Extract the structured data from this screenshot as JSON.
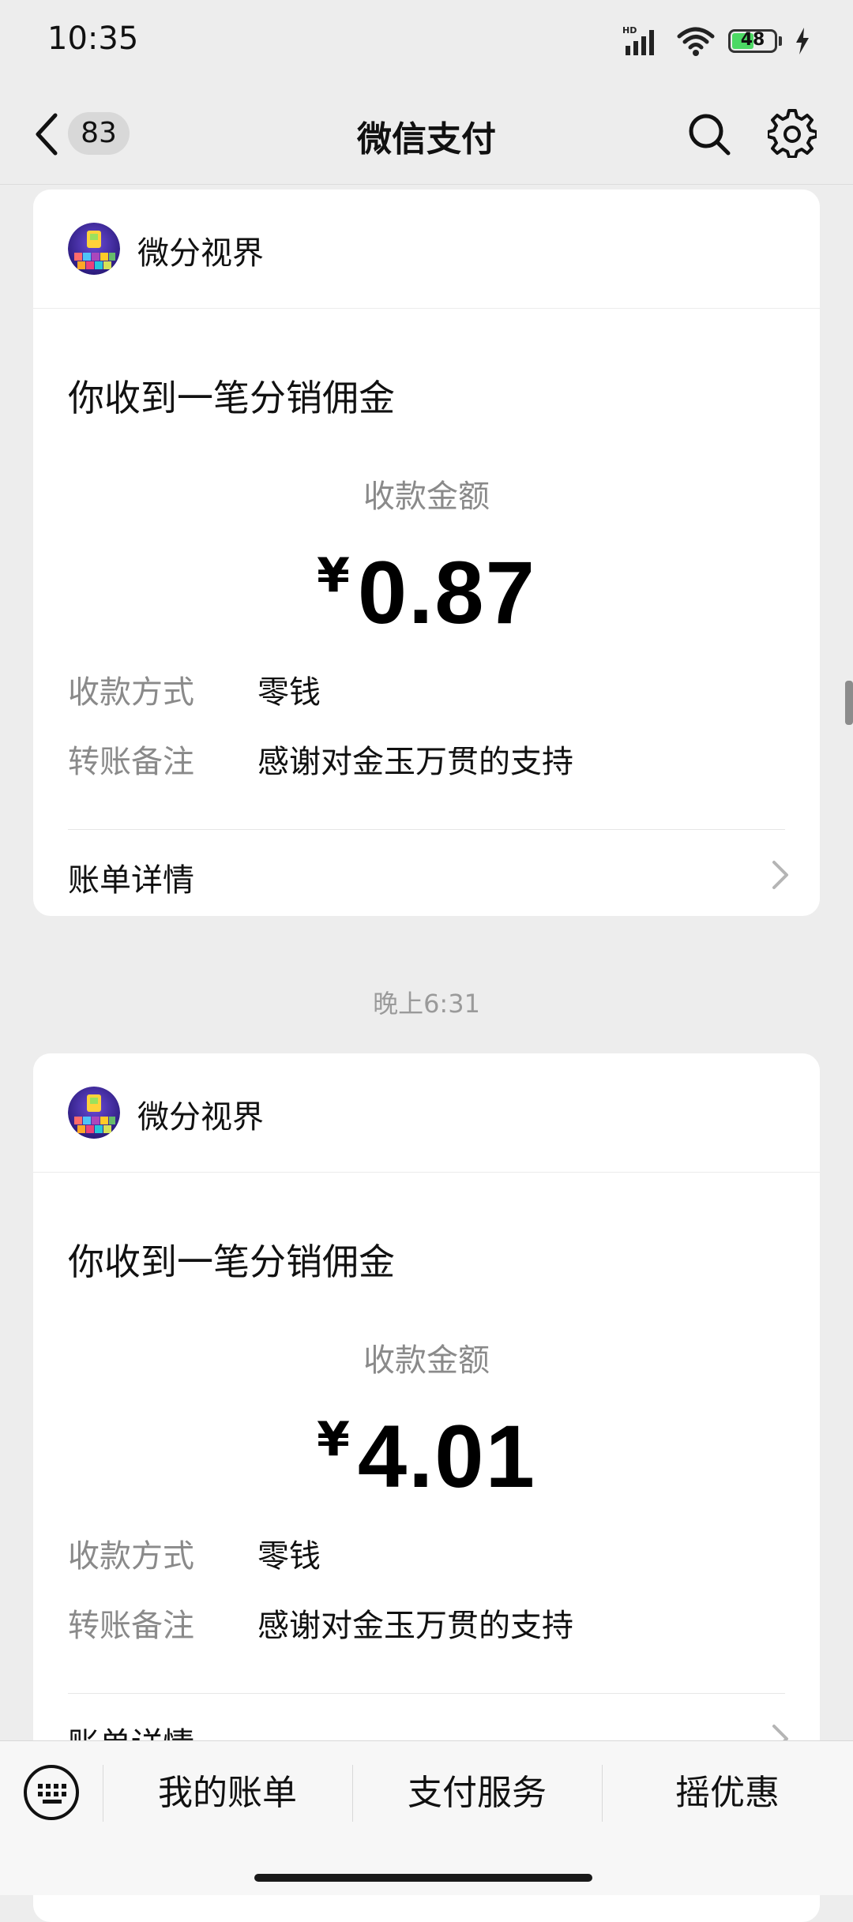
{
  "status_bar": {
    "time": "10:35",
    "network": "HD",
    "battery": "48"
  },
  "nav": {
    "unread_count": "83",
    "title": "微信支付"
  },
  "messages": [
    {
      "merchant": "微分视界",
      "title": "你收到一笔分销佣金",
      "amount_label": "收款金额",
      "currency": "¥",
      "amount": "0.87",
      "method_label": "收款方式",
      "method_value": "零钱",
      "note_label": "转账备注",
      "note_value": "感谢对金玉万贯的支持",
      "bill_detail_label": "账单详情"
    },
    {
      "merchant": "微分视界",
      "title": "你收到一笔分销佣金",
      "amount_label": "收款金额",
      "currency": "¥",
      "amount": "4.01",
      "method_label": "收款方式",
      "method_value": "零钱",
      "note_label": "转账备注",
      "note_value": "感谢对金玉万贯的支持",
      "bill_detail_label": "账单详情"
    }
  ],
  "timestamp": "晚上6:31",
  "bottom_menu": {
    "items": [
      "我的账单",
      "支付服务",
      "摇优惠"
    ]
  },
  "colors": {
    "background": "#ededed",
    "card": "#ffffff",
    "secondary_text": "#8a8a8a",
    "battery_fill": "#4cd964"
  },
  "icons": {
    "back": "chevron-left-icon",
    "search": "search-icon",
    "settings": "gear-icon",
    "keyboard": "keyboard-icon",
    "chevron": "chevron-right-icon"
  }
}
